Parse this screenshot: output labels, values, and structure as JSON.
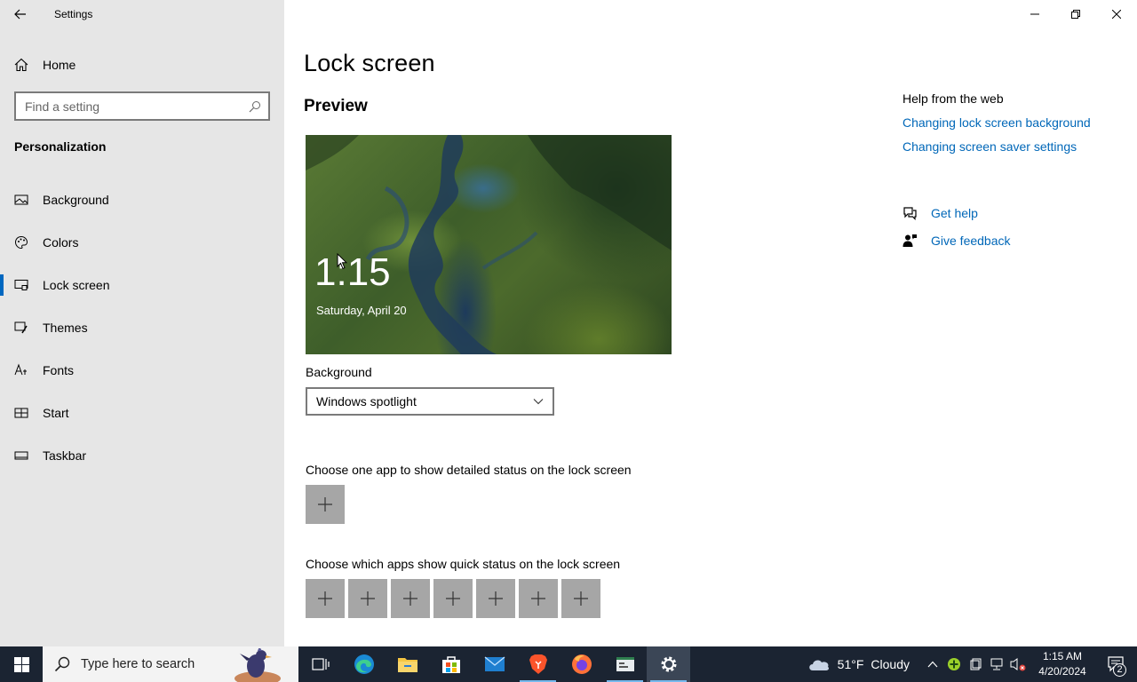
{
  "window": {
    "app_title": "Settings",
    "controls": [
      "minimize",
      "restore",
      "close"
    ]
  },
  "sidebar": {
    "home_label": "Home",
    "search_placeholder": "Find a setting",
    "section_title": "Personalization",
    "items": [
      {
        "label": "Background",
        "icon": "image-icon",
        "selected": false
      },
      {
        "label": "Colors",
        "icon": "palette-icon",
        "selected": false
      },
      {
        "label": "Lock screen",
        "icon": "lock-screen-icon",
        "selected": true
      },
      {
        "label": "Themes",
        "icon": "brush-icon",
        "selected": false
      },
      {
        "label": "Fonts",
        "icon": "font-icon",
        "selected": false
      },
      {
        "label": "Start",
        "icon": "start-icon",
        "selected": false
      },
      {
        "label": "Taskbar",
        "icon": "taskbar-icon",
        "selected": false
      }
    ]
  },
  "main": {
    "title": "Lock screen",
    "preview_heading": "Preview",
    "preview_time": "1:15",
    "preview_date": "Saturday, April 20",
    "background_label": "Background",
    "background_value": "Windows spotlight",
    "detail_status_label": "Choose one app to show detailed status on the lock screen",
    "quick_status_label": "Choose which apps show quick status on the lock screen",
    "quick_status_slots": 7
  },
  "help": {
    "title": "Help from the web",
    "links": [
      "Changing lock screen background",
      "Changing screen saver settings"
    ],
    "get_help": "Get help",
    "give_feedback": "Give feedback"
  },
  "taskbar": {
    "search_placeholder": "Type here to search",
    "apps": [
      "task-view",
      "edge",
      "file-explorer",
      "store",
      "mail",
      "brave",
      "firefox",
      "app-window",
      "settings"
    ],
    "weather_temp": "51°F",
    "weather_condition": "Cloudy",
    "time": "1:15 AM",
    "date": "4/20/2024",
    "notification_count": "2"
  },
  "colors": {
    "accent": "#0067c0",
    "link": "#0067b8",
    "sidebar_bg": "#e6e6e6",
    "taskbar_bg": "#1b2432"
  }
}
